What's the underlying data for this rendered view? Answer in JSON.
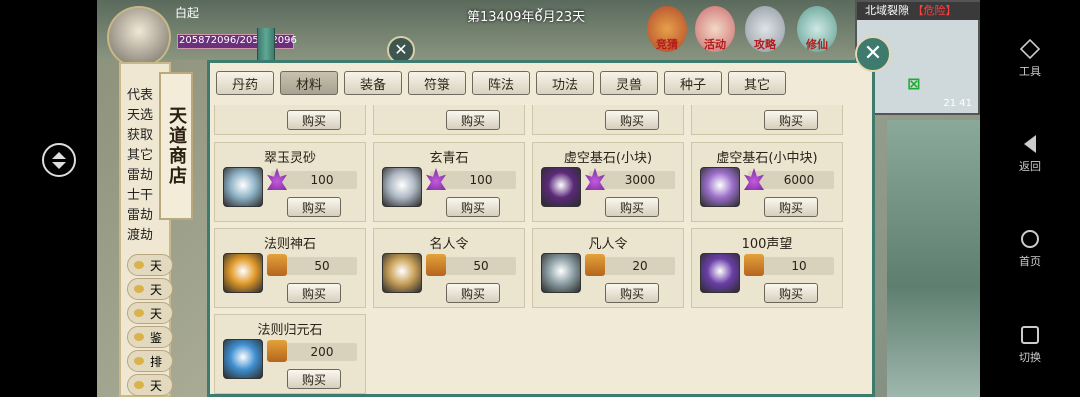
{
  "hud": {
    "player_name": "白起",
    "hp_text": "205872096/205872096",
    "date": "第13409年6月23天",
    "top_icons": [
      "竞猜",
      "活动",
      "攻略",
      "修仙"
    ]
  },
  "map": {
    "title": "北域裂隙",
    "danger": "【危险】",
    "coords": "21 41"
  },
  "shop": {
    "title": "天道商店",
    "tabs": [
      "丹药",
      "材料",
      "装备",
      "符箓",
      "阵法",
      "功法",
      "灵兽",
      "种子",
      "其它"
    ],
    "active_tab": "材料",
    "buy_label": "购买",
    "left_list": [
      "代表",
      "天选",
      "获取",
      "其它",
      "雷劫",
      "士干",
      "雷劫",
      "渡劫"
    ],
    "bubble_items": [
      "天",
      "天",
      "天",
      "鉴",
      "排",
      "天"
    ],
    "items": [
      {
        "name": "翠玉灵砂",
        "currency": "lotus",
        "price": "100",
        "icon_color": "#8fb3c7"
      },
      {
        "name": "玄青石",
        "currency": "lotus",
        "price": "100",
        "icon_color": "#aeb8c4"
      },
      {
        "name": "虚空基石(小块)",
        "currency": "lotus",
        "price": "3000",
        "icon_color": "#5b2a7a"
      },
      {
        "name": "虚空基石(小中块)",
        "currency": "lotus",
        "price": "6000",
        "icon_color": "#9b6fc9"
      },
      {
        "name": "法则神石",
        "currency": "scroll",
        "price": "50",
        "icon_color": "#e09a2b"
      },
      {
        "name": "名人令",
        "currency": "scroll",
        "price": "50",
        "icon_color": "#caa25a"
      },
      {
        "name": "凡人令",
        "currency": "scroll",
        "price": "20",
        "icon_color": "#8da0a6"
      },
      {
        "name": "100声望",
        "currency": "scroll",
        "price": "10",
        "icon_color": "#6a3fa8"
      },
      {
        "name": "法则归元石",
        "currency": "scroll",
        "price": "200",
        "icon_color": "#3f8fd0"
      }
    ]
  },
  "android_nav": {
    "tools": "工具",
    "back": "返回",
    "home": "首页",
    "switch": "切换"
  }
}
